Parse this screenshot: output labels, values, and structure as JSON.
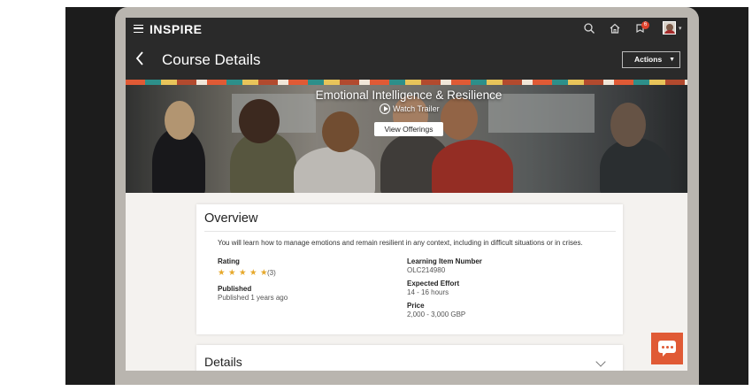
{
  "app": {
    "brand": "INSPIRE",
    "notification_count": "6"
  },
  "header": {
    "title": "Course Details",
    "actions_label": "Actions"
  },
  "hero": {
    "course_title": "Emotional Intelligence & Resilience",
    "watch_trailer_label": "Watch Trailer",
    "view_offerings_label": "View Offerings"
  },
  "overview": {
    "title": "Overview",
    "description": "You will learn how to manage emotions and remain resilient in any context, including in difficult situations or in crises.",
    "rating_label": "Rating",
    "rating_stars": 5,
    "rating_count": "(3)",
    "published_label": "Published",
    "published_value": "Published 1 years ago",
    "learning_item_number_label": "Learning Item Number",
    "learning_item_number_value": "OLC214980",
    "expected_effort_label": "Expected Effort",
    "expected_effort_value": "14 - 16 hours",
    "price_label": "Price",
    "price_value": "2,000 - 3,000 GBP"
  },
  "details": {
    "title": "Details"
  },
  "colors": {
    "accent": "#e05a35",
    "topbar": "#2a2a2a",
    "star": "#e6a82a"
  },
  "icons": [
    "hamburger-icon",
    "search-icon",
    "home-icon",
    "notifications-icon",
    "back-icon",
    "play-icon",
    "star-icon",
    "chevron-down-icon",
    "chat-icon"
  ]
}
